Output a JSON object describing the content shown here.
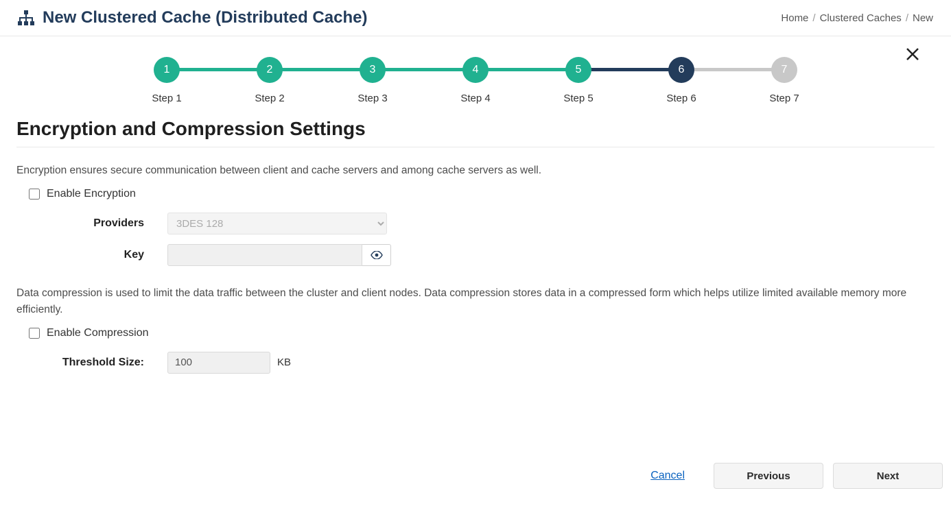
{
  "header": {
    "title": "New Clustered Cache (Distributed Cache)",
    "breadcrumb": {
      "home": "Home",
      "mid": "Clustered Caches",
      "current": "New"
    }
  },
  "steps": {
    "labels": [
      "Step 1",
      "Step 2",
      "Step 3",
      "Step 4",
      "Step 5",
      "Step 6",
      "Step 7"
    ],
    "numbers": [
      "1",
      "2",
      "3",
      "4",
      "5",
      "6",
      "7"
    ]
  },
  "section": {
    "title": "Encryption and Compression Settings",
    "encryption_desc": "Encryption ensures secure communication between client and cache servers and among cache servers as well.",
    "enable_encryption_label": "Enable Encryption",
    "providers_label": "Providers",
    "providers_value": "3DES 128",
    "key_label": "Key",
    "key_value": "",
    "compression_desc": "Data compression is used to limit the data traffic between the cluster and client nodes. Data compression stores data in a compressed form which helps utilize limited available memory more efficiently.",
    "enable_compression_label": "Enable Compression",
    "threshold_label": "Threshold Size:",
    "threshold_value": "100",
    "threshold_unit": "KB"
  },
  "footer": {
    "cancel": "Cancel",
    "previous": "Previous",
    "next": "Next"
  }
}
